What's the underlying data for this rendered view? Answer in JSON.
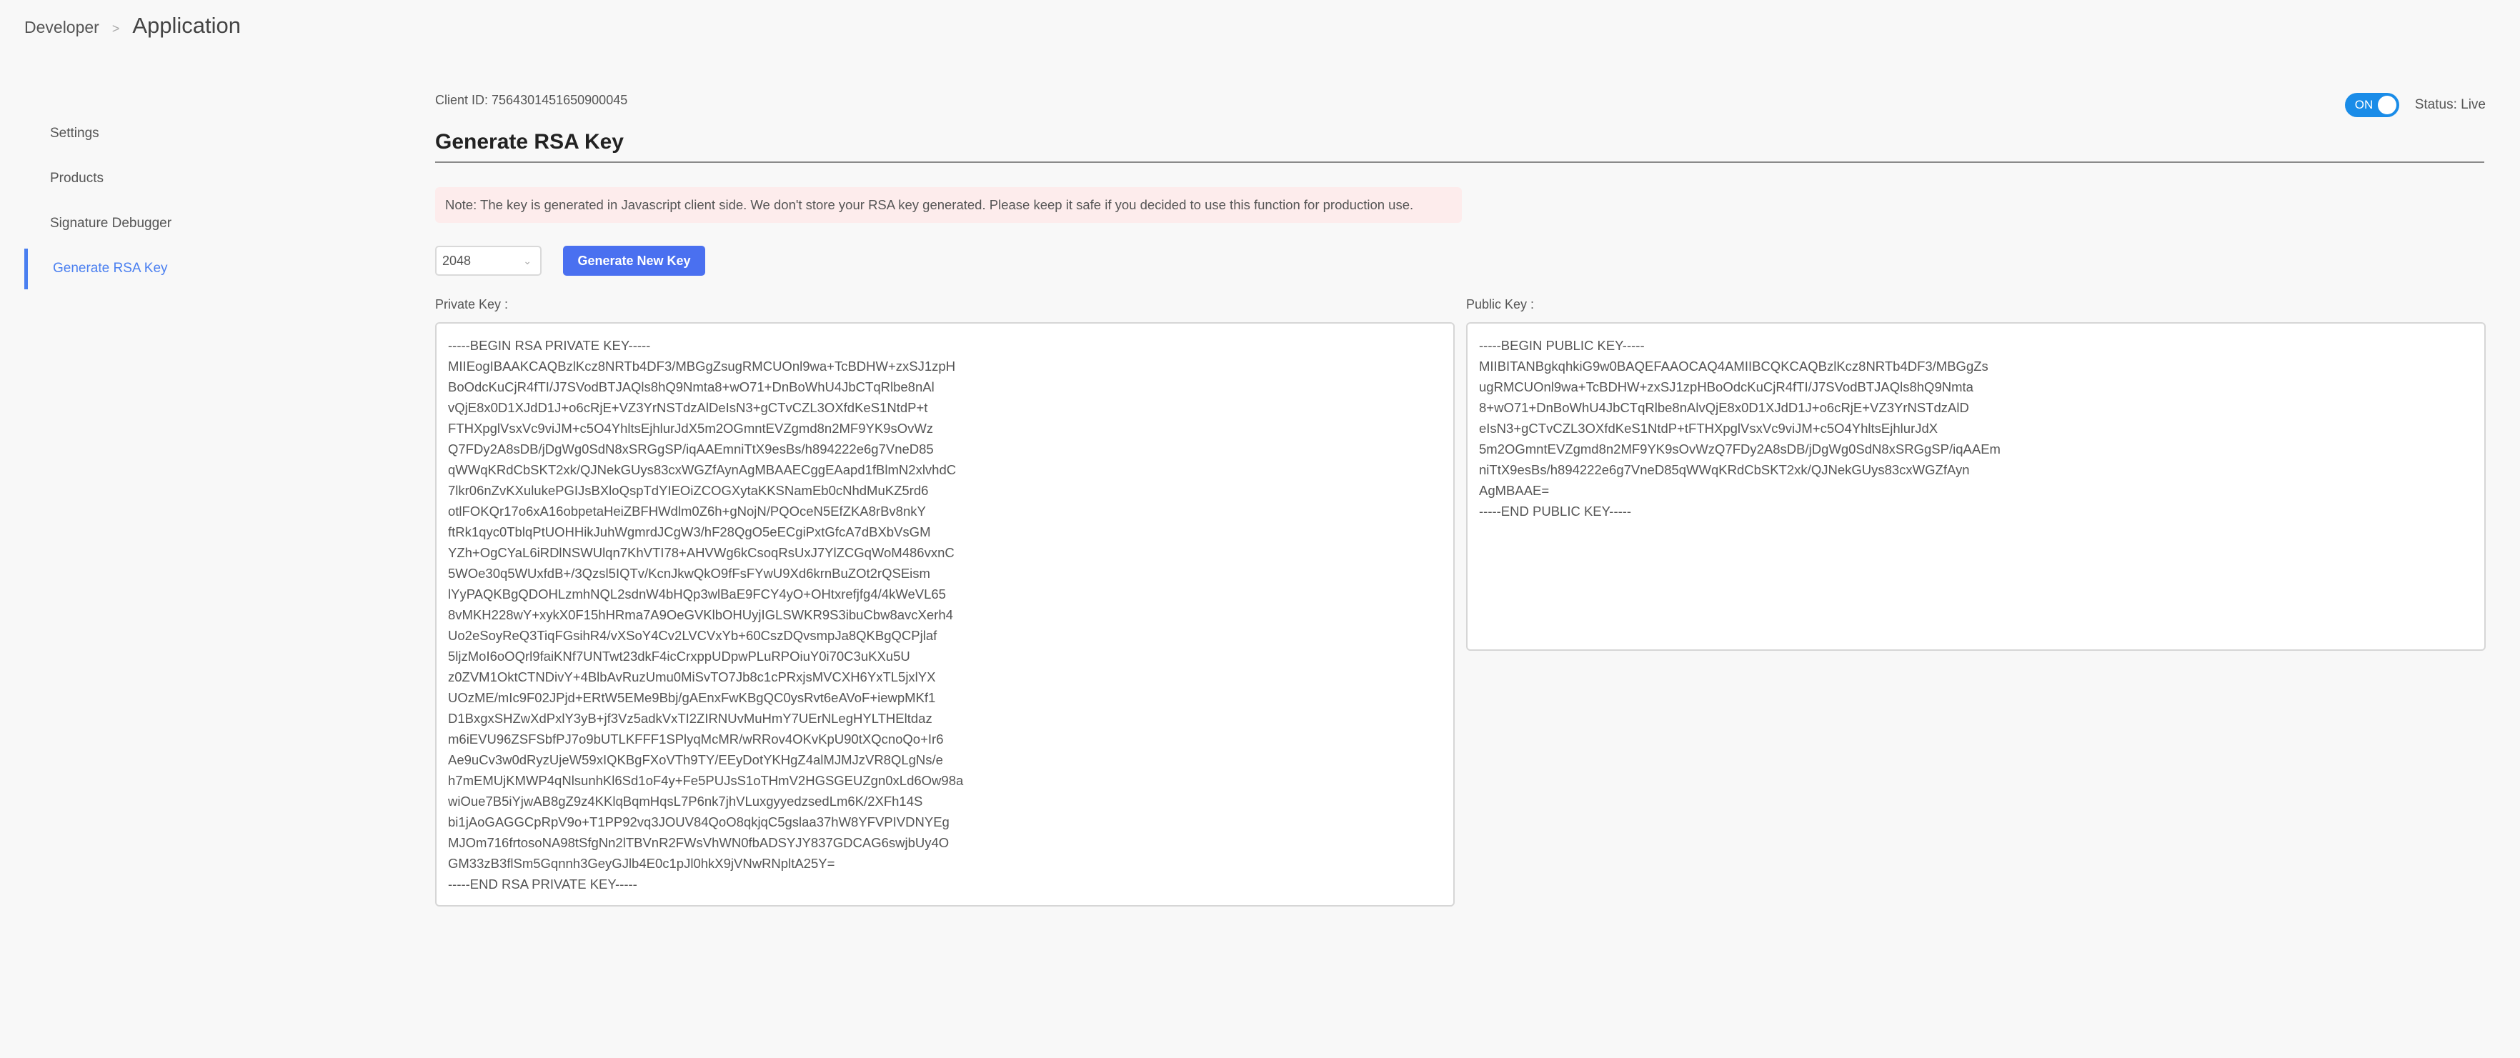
{
  "breadcrumb": {
    "parent": "Developer",
    "separator": ">",
    "current": "Application"
  },
  "sidebar": {
    "items": [
      {
        "label": "Settings",
        "active": false
      },
      {
        "label": "Products",
        "active": false
      },
      {
        "label": "Signature Debugger",
        "active": false
      },
      {
        "label": "Generate RSA Key",
        "active": true
      }
    ]
  },
  "header": {
    "client_id": "Client ID: 7564301451650900045",
    "title": "Generate RSA Key",
    "toggle_label": "ON",
    "toggle_state": true,
    "status": "Status: Live"
  },
  "note": "Note: The key is generated in Javascript client side. We don't store your RSA key generated. Please keep it safe if you decided to use this function for production use.",
  "controls": {
    "key_size_selected": "2048",
    "chevron_icon": "⌄",
    "generate_label": "Generate New Key"
  },
  "private_key": {
    "label": "Private Key :",
    "value": "-----BEGIN RSA PRIVATE KEY-----\nMIIEogIBAAKCAQBzlKcz8NRTb4DF3/MBGgZsugRMCUOnl9wa+TcBDHW+zxSJ1zpH\nBoOdcKuCjR4fTI/J7SVodBTJAQls8hQ9Nmta8+wO71+DnBoWhU4JbCTqRlbe8nAl\nvQjE8x0D1XJdD1J+o6cRjE+VZ3YrNSTdzAlDeIsN3+gCTvCZL3OXfdKeS1NtdP+t\nFTHXpglVsxVc9viJM+c5O4YhltsEjhlurJdX5m2OGmntEVZgmd8n2MF9YK9sOvWz\nQ7FDy2A8sDB/jDgWg0SdN8xSRGgSP/iqAAEmniTtX9esBs/h894222e6g7VneD85\nqWWqKRdCbSKT2xk/QJNekGUys83cxWGZfAynAgMBAAECggEAapd1fBlmN2xlvhdC\n7lkr06nZvKXulukePGIJsBXloQspTdYIEOiZCOGXytaKKSNamEb0cNhdMuKZ5rd6\notlFOKQr17o6xA16obpetaHeiZBFHWdlm0Z6h+gNojN/PQOceN5EfZKA8rBv8nkY\nftRk1qyc0TblqPtUOHHikJuhWgmrdJCgW3/hF28QgO5eECgiPxtGfcA7dBXbVsGM\nYZh+OgCYaL6iRDlNSWUlqn7KhVTI78+AHVWg6kCsoqRsUxJ7YlZCGqWoM486vxnC\n5WOe30q5WUxfdB+/3Qzsl5IQTv/KcnJkwQkO9fFsFYwU9Xd6krnBuZOt2rQSEism\nlYyPAQKBgQDOHLzmhNQL2sdnW4bHQp3wlBaE9FCY4yO+OHtxrefjfg4/4kWeVL65\n8vMKH228wY+xykX0F15hHRma7A9OeGVKlbOHUyjIGLSWKR9S3ibuCbw8avcXerh4\nUo2eSoyReQ3TiqFGsihR4/vXSoY4Cv2LVCVxYb+60CszDQvsmpJa8QKBgQCPjlaf\n5ljzMoI6oOQrl9faiKNf7UNTwt23dkF4icCrxppUDpwPLuRPOiuY0i70C3uKXu5U\nz0ZVM1OktCTNDivY+4BlbAvRuzUmu0MiSvTO7Jb8c1cPRxjsMVCXH6YxTL5jxlYX\nUOzME/mIc9F02JPjd+ERtW5EMe9Bbj/gAEnxFwKBgQC0ysRvt6eAVoF+iewpMKf1\nD1BxgxSHZwXdPxlY3yB+jf3Vz5adkVxTI2ZIRNUvMuHmY7UErNLegHYLTHEltdaz\nm6iEVU96ZSFSbfPJ7o9bUTLKFFF1SPlyqMcMR/wRRov4OKvKpU90tXQcnoQo+Ir6\nAe9uCv3w0dRyzUjeW59xIQKBgFXoVTh9TY/EEyDotYKHgZ4alMJMJzVR8QLgNs/e\nh7mEMUjKMWP4qNlsunhKl6Sd1oF4y+Fe5PUJsS1oTHmV2HGSGEUZgn0xLd6Ow98a\nwiOue7B5iYjwAB8gZ9z4KKlqBqmHqsL7P6nk7jhVLuxgyyedzsedLm6K/2XFh14S\nbi1jAoGAGGCpRpV9o+T1PP92vq3JOUV84QoO8qkjqC5gslaa37hW8YFVPIVDNYEg\nMJOm716frtosoNA98tSfgNn2lTBVnR2FWsVhWN0fbADSYJY837GDCAG6swjbUy4O\nGM33zB3flSm5Gqnnh3GeyGJlb4E0c1pJl0hkX9jVNwRNpltA25Y=\n-----END RSA PRIVATE KEY-----"
  },
  "public_key": {
    "label": "Public Key :",
    "value": "-----BEGIN PUBLIC KEY-----\nMIIBITANBgkqhkiG9w0BAQEFAAOCAQ4AMIIBCQKCAQBzlKcz8NRTb4DF3/MBGgZs\nugRMCUOnl9wa+TcBDHW+zxSJ1zpHBoOdcKuCjR4fTI/J7SVodBTJAQls8hQ9Nmta\n8+wO71+DnBoWhU4JbCTqRlbe8nAlvQjE8x0D1XJdD1J+o6cRjE+VZ3YrNSTdzAlD\neIsN3+gCTvCZL3OXfdKeS1NtdP+tFTHXpglVsxVc9viJM+c5O4YhltsEjhlurJdX\n5m2OGmntEVZgmd8n2MF9YK9sOvWzQ7FDy2A8sDB/jDgWg0SdN8xSRGgSP/iqAAEm\nniTtX9esBs/h894222e6g7VneD85qWWqKRdCbSKT2xk/QJNekGUys83cxWGZfAyn\nAgMBAAE=\n-----END PUBLIC KEY-----"
  },
  "colors": {
    "accent": "#4a7ff0",
    "button": "#4a70f0",
    "toggle_on": "#1a8ce8",
    "note_bg": "#fdecec"
  }
}
